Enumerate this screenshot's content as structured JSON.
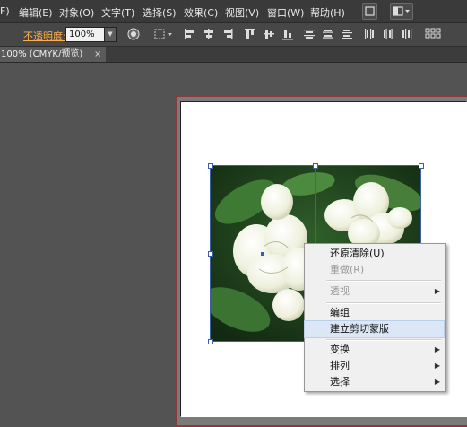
{
  "menubar": {
    "items": [
      "F)",
      "编辑(E)",
      "对象(O)",
      "文字(T)",
      "选择(S)",
      "效果(C)",
      "视图(V)",
      "窗口(W)",
      "帮助(H)"
    ]
  },
  "control_bar": {
    "opacity_label": "不透明度:",
    "opacity_value": "100%"
  },
  "document_tab": {
    "title": "100% (CMYK/预览)",
    "close": "×"
  },
  "context_menu": {
    "items": [
      {
        "label": "还原清除(U)",
        "enabled": true
      },
      {
        "label": "重做(R)",
        "enabled": false
      },
      {
        "label": "透视",
        "enabled": false,
        "submenu": true
      },
      {
        "label": "编组",
        "enabled": true
      },
      {
        "label": "建立剪切蒙版",
        "enabled": true,
        "highlighted": true
      },
      {
        "label": "变换",
        "enabled": true,
        "submenu": true
      },
      {
        "label": "排列",
        "enabled": true,
        "submenu": true
      },
      {
        "label": "选择",
        "enabled": true,
        "submenu": true
      }
    ]
  },
  "colors": {
    "workspace": "#535353",
    "opacity_label": "#ffae4a",
    "artboard_border": "#8a3a3a",
    "selection": "#3d5fa8",
    "highlight": "#dbe7f6"
  }
}
